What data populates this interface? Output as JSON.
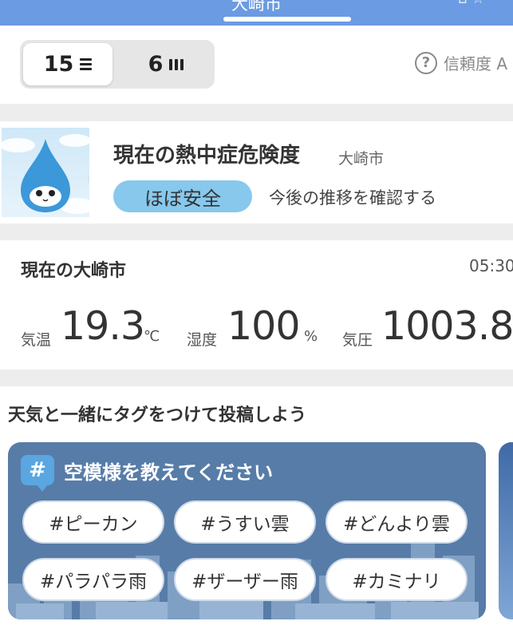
{
  "header": {
    "city": "大崎市",
    "right_fragment": "⌂ ☆"
  },
  "view_toggle": {
    "options": [
      {
        "label": "15",
        "icon": "list-icon",
        "active": true
      },
      {
        "label": "6",
        "icon": "bars-icon",
        "active": false
      }
    ]
  },
  "reliability": {
    "icon": "question-icon",
    "label": "信頼度 A"
  },
  "heatstroke": {
    "title": "現在の熱中症危険度",
    "city": "大崎市",
    "level": "ほぼ安全",
    "level_color": "#87c8ec",
    "trend_link": "今後の推移を確認する"
  },
  "current_weather": {
    "title": "現在の大崎市",
    "time": "05:30",
    "temperature": {
      "label": "気温",
      "value": "19.3",
      "unit": "℃"
    },
    "humidity": {
      "label": "湿度",
      "value": "100",
      "unit": "%"
    },
    "pressure": {
      "label": "気圧",
      "value": "1003.8"
    }
  },
  "post": {
    "title": "天気と一緒にタグをつけて投稿しよう",
    "card_title": "空模様を教えてください",
    "hash_symbol": "#",
    "tags": [
      "#ピーカン",
      "#うすい雲",
      "#どんより雲",
      "#パラパラ雨",
      "#ザーザー雨",
      "#カミナリ"
    ]
  }
}
